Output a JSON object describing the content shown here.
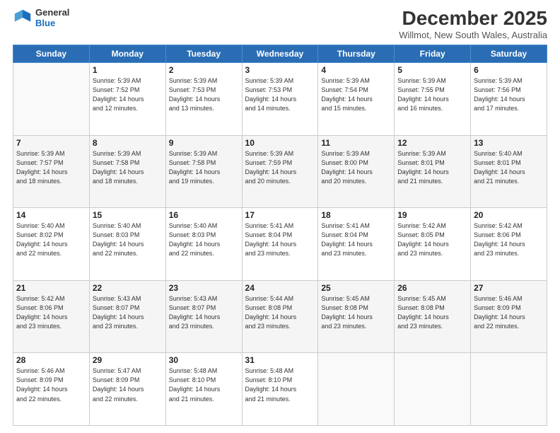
{
  "logo": {
    "line1": "General",
    "line2": "Blue"
  },
  "title": "December 2025",
  "subtitle": "Willmot, New South Wales, Australia",
  "days_header": [
    "Sunday",
    "Monday",
    "Tuesday",
    "Wednesday",
    "Thursday",
    "Friday",
    "Saturday"
  ],
  "weeks": [
    [
      {
        "day": "",
        "detail": ""
      },
      {
        "day": "1",
        "detail": "Sunrise: 5:39 AM\nSunset: 7:52 PM\nDaylight: 14 hours\nand 12 minutes."
      },
      {
        "day": "2",
        "detail": "Sunrise: 5:39 AM\nSunset: 7:53 PM\nDaylight: 14 hours\nand 13 minutes."
      },
      {
        "day": "3",
        "detail": "Sunrise: 5:39 AM\nSunset: 7:53 PM\nDaylight: 14 hours\nand 14 minutes."
      },
      {
        "day": "4",
        "detail": "Sunrise: 5:39 AM\nSunset: 7:54 PM\nDaylight: 14 hours\nand 15 minutes."
      },
      {
        "day": "5",
        "detail": "Sunrise: 5:39 AM\nSunset: 7:55 PM\nDaylight: 14 hours\nand 16 minutes."
      },
      {
        "day": "6",
        "detail": "Sunrise: 5:39 AM\nSunset: 7:56 PM\nDaylight: 14 hours\nand 17 minutes."
      }
    ],
    [
      {
        "day": "7",
        "detail": "Sunrise: 5:39 AM\nSunset: 7:57 PM\nDaylight: 14 hours\nand 18 minutes."
      },
      {
        "day": "8",
        "detail": "Sunrise: 5:39 AM\nSunset: 7:58 PM\nDaylight: 14 hours\nand 18 minutes."
      },
      {
        "day": "9",
        "detail": "Sunrise: 5:39 AM\nSunset: 7:58 PM\nDaylight: 14 hours\nand 19 minutes."
      },
      {
        "day": "10",
        "detail": "Sunrise: 5:39 AM\nSunset: 7:59 PM\nDaylight: 14 hours\nand 20 minutes."
      },
      {
        "day": "11",
        "detail": "Sunrise: 5:39 AM\nSunset: 8:00 PM\nDaylight: 14 hours\nand 20 minutes."
      },
      {
        "day": "12",
        "detail": "Sunrise: 5:39 AM\nSunset: 8:01 PM\nDaylight: 14 hours\nand 21 minutes."
      },
      {
        "day": "13",
        "detail": "Sunrise: 5:40 AM\nSunset: 8:01 PM\nDaylight: 14 hours\nand 21 minutes."
      }
    ],
    [
      {
        "day": "14",
        "detail": "Sunrise: 5:40 AM\nSunset: 8:02 PM\nDaylight: 14 hours\nand 22 minutes."
      },
      {
        "day": "15",
        "detail": "Sunrise: 5:40 AM\nSunset: 8:03 PM\nDaylight: 14 hours\nand 22 minutes."
      },
      {
        "day": "16",
        "detail": "Sunrise: 5:40 AM\nSunset: 8:03 PM\nDaylight: 14 hours\nand 22 minutes."
      },
      {
        "day": "17",
        "detail": "Sunrise: 5:41 AM\nSunset: 8:04 PM\nDaylight: 14 hours\nand 23 minutes."
      },
      {
        "day": "18",
        "detail": "Sunrise: 5:41 AM\nSunset: 8:04 PM\nDaylight: 14 hours\nand 23 minutes."
      },
      {
        "day": "19",
        "detail": "Sunrise: 5:42 AM\nSunset: 8:05 PM\nDaylight: 14 hours\nand 23 minutes."
      },
      {
        "day": "20",
        "detail": "Sunrise: 5:42 AM\nSunset: 8:06 PM\nDaylight: 14 hours\nand 23 minutes."
      }
    ],
    [
      {
        "day": "21",
        "detail": "Sunrise: 5:42 AM\nSunset: 8:06 PM\nDaylight: 14 hours\nand 23 minutes."
      },
      {
        "day": "22",
        "detail": "Sunrise: 5:43 AM\nSunset: 8:07 PM\nDaylight: 14 hours\nand 23 minutes."
      },
      {
        "day": "23",
        "detail": "Sunrise: 5:43 AM\nSunset: 8:07 PM\nDaylight: 14 hours\nand 23 minutes."
      },
      {
        "day": "24",
        "detail": "Sunrise: 5:44 AM\nSunset: 8:08 PM\nDaylight: 14 hours\nand 23 minutes."
      },
      {
        "day": "25",
        "detail": "Sunrise: 5:45 AM\nSunset: 8:08 PM\nDaylight: 14 hours\nand 23 minutes."
      },
      {
        "day": "26",
        "detail": "Sunrise: 5:45 AM\nSunset: 8:08 PM\nDaylight: 14 hours\nand 23 minutes."
      },
      {
        "day": "27",
        "detail": "Sunrise: 5:46 AM\nSunset: 8:09 PM\nDaylight: 14 hours\nand 22 minutes."
      }
    ],
    [
      {
        "day": "28",
        "detail": "Sunrise: 5:46 AM\nSunset: 8:09 PM\nDaylight: 14 hours\nand 22 minutes."
      },
      {
        "day": "29",
        "detail": "Sunrise: 5:47 AM\nSunset: 8:09 PM\nDaylight: 14 hours\nand 22 minutes."
      },
      {
        "day": "30",
        "detail": "Sunrise: 5:48 AM\nSunset: 8:10 PM\nDaylight: 14 hours\nand 21 minutes."
      },
      {
        "day": "31",
        "detail": "Sunrise: 5:48 AM\nSunset: 8:10 PM\nDaylight: 14 hours\nand 21 minutes."
      },
      {
        "day": "",
        "detail": ""
      },
      {
        "day": "",
        "detail": ""
      },
      {
        "day": "",
        "detail": ""
      }
    ]
  ]
}
